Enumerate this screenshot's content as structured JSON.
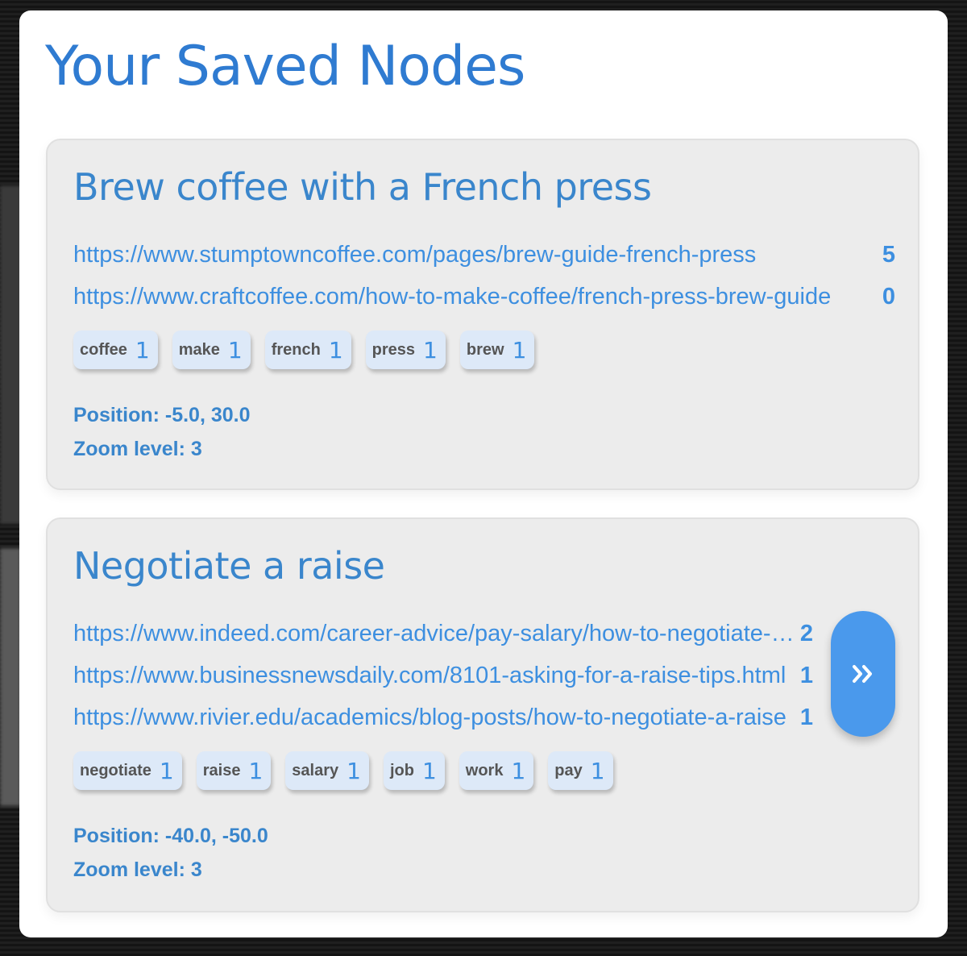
{
  "modal": {
    "title": "Your Saved Nodes"
  },
  "nodes": [
    {
      "title": "Brew coffee with a French press",
      "urls": [
        {
          "url": "https://www.stumptowncoffee.com/pages/brew-guide-french-press",
          "count": "5"
        },
        {
          "url": "https://www.craftcoffee.com/how-to-make-coffee/french-press-brew-guide",
          "count": "0"
        }
      ],
      "keywords": [
        {
          "word": "coffee",
          "count": "1"
        },
        {
          "word": "make",
          "count": "1"
        },
        {
          "word": "french",
          "count": "1"
        },
        {
          "word": "press",
          "count": "1"
        },
        {
          "word": "brew",
          "count": "1"
        }
      ],
      "position": "Position: -5.0, 30.0",
      "zoom": "Zoom level: 3"
    },
    {
      "title": "Negotiate a raise",
      "urls": [
        {
          "url": "https://www.indeed.com/career-advice/pay-salary/how-to-negotiate-a-raise",
          "count": "2"
        },
        {
          "url": "https://www.businessnewsdaily.com/8101-asking-for-a-raise-tips.html",
          "count": "1"
        },
        {
          "url": "https://www.rivier.edu/academics/blog-posts/how-to-negotiate-a-raise",
          "count": "1"
        }
      ],
      "keywords": [
        {
          "word": "negotiate",
          "count": "1"
        },
        {
          "word": "raise",
          "count": "1"
        },
        {
          "word": "salary",
          "count": "1"
        },
        {
          "word": "job",
          "count": "1"
        },
        {
          "word": "work",
          "count": "1"
        },
        {
          "word": "pay",
          "count": "1"
        }
      ],
      "position": "Position: -40.0, -50.0",
      "zoom": "Zoom level: 3",
      "open_button_icon": "double-chevron-right-icon"
    }
  ],
  "colors": {
    "accent": "#3d8fe0",
    "title": "#2f7bd1",
    "card_bg": "#ececec",
    "chip_bg": "#dde9f8",
    "button_bg": "#4a99ec"
  }
}
